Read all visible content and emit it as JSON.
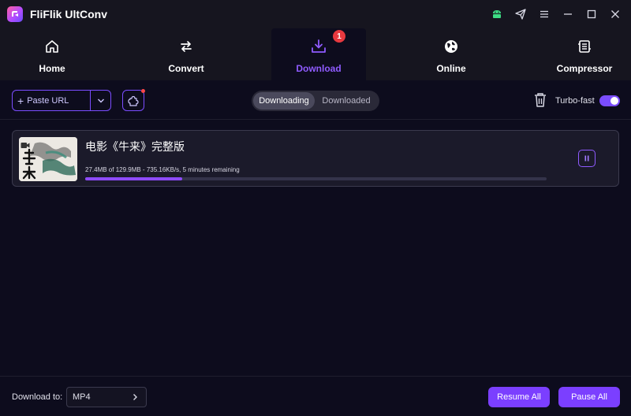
{
  "app": {
    "title": "FliFlik UltConv"
  },
  "window_icons": [
    "android-icon",
    "send-icon",
    "menu-icon",
    "minimize-icon",
    "maximize-icon",
    "close-icon"
  ],
  "nav": {
    "items": [
      {
        "label": "Home",
        "icon": "home-icon"
      },
      {
        "label": "Convert",
        "icon": "convert-icon"
      },
      {
        "label": "Download",
        "icon": "download-icon",
        "active": true,
        "badge": "1"
      },
      {
        "label": "Online",
        "icon": "globe-icon"
      },
      {
        "label": "Compressor",
        "icon": "compressor-icon"
      }
    ]
  },
  "toolbar": {
    "paste_label": "Paste URL",
    "tabs": [
      "Downloading",
      "Downloaded"
    ],
    "turbo_label": "Turbo-fast",
    "turbo_on": true
  },
  "downloads": [
    {
      "title": "电影《牛来》完整版",
      "progress_text": "27.4MB of 129.9MB -  735.16KB/s, 5 minutes remaining",
      "progress_fraction": 0.211
    }
  ],
  "footer": {
    "download_to_label": "Download to:",
    "format": "MP4",
    "resume_all": "Resume All",
    "pause_all": "Pause All"
  },
  "colors": {
    "accent": "#7b3fff",
    "active_tab_text": "#8f5bff",
    "badge": "#e8393f",
    "android": "#3ddc84"
  }
}
